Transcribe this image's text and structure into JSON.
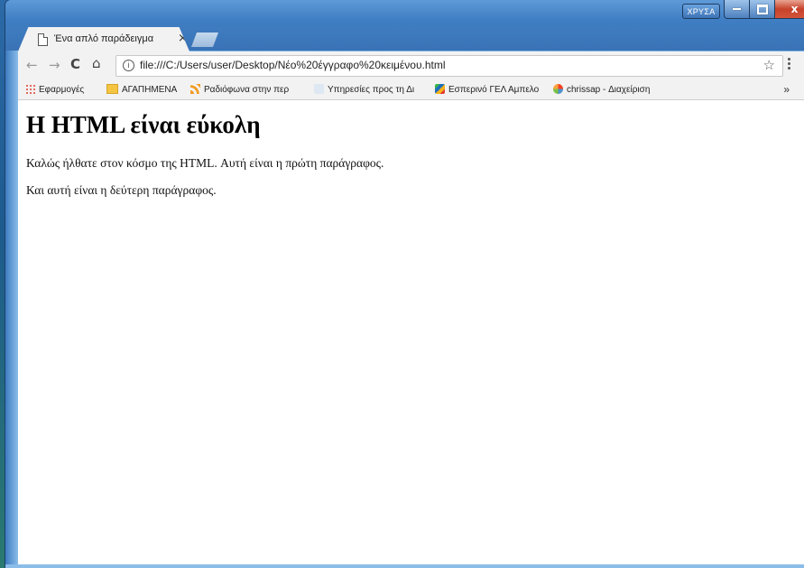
{
  "window": {
    "lang_indicator": "ΧΡΥΣΑ",
    "close_glyph": "x"
  },
  "tab": {
    "title": "Ένα απλό παράδειγμα",
    "close": "×"
  },
  "toolbar": {
    "back": "←",
    "forward": "→",
    "reload": "C",
    "home": "⌂",
    "info": "i",
    "url": "file:///C:/Users/user/Desktop/Νέο%20έγγραφο%20κειμένου.html",
    "star": "☆"
  },
  "bookmarks": {
    "items": [
      {
        "label": "Εφαρμογές",
        "icon": "apps-icon"
      },
      {
        "label": "ΑΓΑΠΗΜΕΝΑ",
        "icon": "folder-icon"
      },
      {
        "label": "Ραδιόφωνα στην περ",
        "icon": "rss-icon"
      },
      {
        "label": "Υπηρεσίες προς τη Δι",
        "icon": "gov-icon"
      },
      {
        "label": "Εσπερινό ΓΕΛ Αμπελο",
        "icon": "school-icon"
      },
      {
        "label": "chrissap - Διαχείριση",
        "icon": "joomla-icon"
      }
    ],
    "more": "»"
  },
  "page": {
    "heading": "Η HTML είναι εύκολη",
    "paragraph1": "Καλώς ήλθατε στον κόσμο της HTML. Αυτή είναι η πρώτη παράγραφος.",
    "paragraph2": "Και αυτή είναι η δεύτερη παράγραφος."
  }
}
